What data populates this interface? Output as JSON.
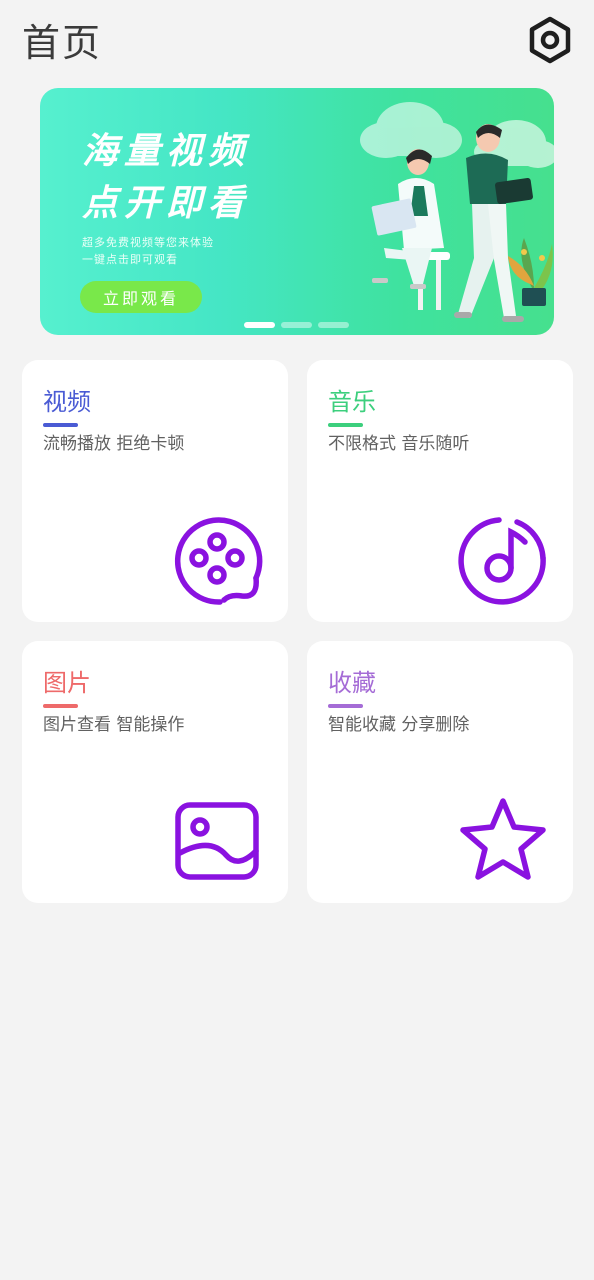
{
  "header": {
    "title": "首页",
    "settings_icon": "settings-hexagon-icon"
  },
  "banner": {
    "headline_line1": "海量视频",
    "headline_line2": "点开即看",
    "sub_line1": "超多免费视频等您来体验",
    "sub_line2": "一键点击即可观看",
    "cta_label": "立即观看",
    "page_count": 3,
    "active_page": 1
  },
  "cards": [
    {
      "title": "视频",
      "desc": "流畅播放 拒绝卡顿",
      "accent": "#4a5bd4",
      "icon": "film-reel-icon"
    },
    {
      "title": "音乐",
      "desc": "不限格式 音乐随听",
      "accent": "#3ccf7d",
      "icon": "music-note-icon"
    },
    {
      "title": "图片",
      "desc": "图片查看 智能操作",
      "accent": "#ee6a6a",
      "icon": "image-icon"
    },
    {
      "title": "收藏",
      "desc": "智能收藏 分享删除",
      "accent": "#a56cd6",
      "icon": "star-icon"
    }
  ],
  "colors": {
    "background": "#f3f3f3",
    "icon_purple": "#8a12e0"
  }
}
